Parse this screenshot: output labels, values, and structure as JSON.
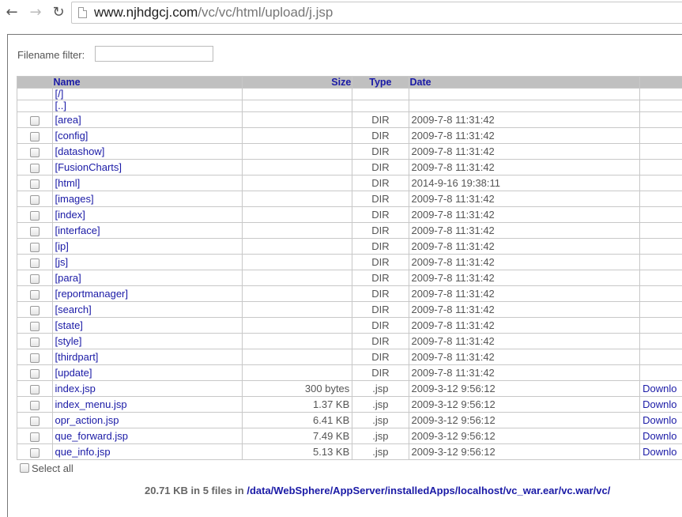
{
  "browser": {
    "back_icon": "arrow-left-icon",
    "forward_icon": "arrow-right-icon",
    "reload_icon": "reload-icon",
    "url_domain": "www.njhdgcj.com",
    "url_path": "/vc/vc/html/upload/j.jsp"
  },
  "filter": {
    "label": "Filename filter:",
    "value": ""
  },
  "table": {
    "headers": {
      "name": "Name",
      "size": "Size",
      "type": "Type",
      "date": "Date"
    },
    "parents": [
      "[/]",
      "[..]"
    ],
    "rows": [
      {
        "name": "[area]",
        "size": "",
        "type": "DIR",
        "date": "2009-7-8 11:31:42",
        "link": ""
      },
      {
        "name": "[config]",
        "size": "",
        "type": "DIR",
        "date": "2009-7-8 11:31:42",
        "link": ""
      },
      {
        "name": "[datashow]",
        "size": "",
        "type": "DIR",
        "date": "2009-7-8 11:31:42",
        "link": ""
      },
      {
        "name": "[FusionCharts]",
        "size": "",
        "type": "DIR",
        "date": "2009-7-8 11:31:42",
        "link": ""
      },
      {
        "name": "[html]",
        "size": "",
        "type": "DIR",
        "date": "2014-9-16 19:38:11",
        "link": ""
      },
      {
        "name": "[images]",
        "size": "",
        "type": "DIR",
        "date": "2009-7-8 11:31:42",
        "link": ""
      },
      {
        "name": "[index]",
        "size": "",
        "type": "DIR",
        "date": "2009-7-8 11:31:42",
        "link": ""
      },
      {
        "name": "[interface]",
        "size": "",
        "type": "DIR",
        "date": "2009-7-8 11:31:42",
        "link": ""
      },
      {
        "name": "[ip]",
        "size": "",
        "type": "DIR",
        "date": "2009-7-8 11:31:42",
        "link": ""
      },
      {
        "name": "[js]",
        "size": "",
        "type": "DIR",
        "date": "2009-7-8 11:31:42",
        "link": ""
      },
      {
        "name": "[para]",
        "size": "",
        "type": "DIR",
        "date": "2009-7-8 11:31:42",
        "link": ""
      },
      {
        "name": "[reportmanager]",
        "size": "",
        "type": "DIR",
        "date": "2009-7-8 11:31:42",
        "link": ""
      },
      {
        "name": "[search]",
        "size": "",
        "type": "DIR",
        "date": "2009-7-8 11:31:42",
        "link": ""
      },
      {
        "name": "[state]",
        "size": "",
        "type": "DIR",
        "date": "2009-7-8 11:31:42",
        "link": ""
      },
      {
        "name": "[style]",
        "size": "",
        "type": "DIR",
        "date": "2009-7-8 11:31:42",
        "link": ""
      },
      {
        "name": "[thirdpart]",
        "size": "",
        "type": "DIR",
        "date": "2009-7-8 11:31:42",
        "link": ""
      },
      {
        "name": "[update]",
        "size": "",
        "type": "DIR",
        "date": "2009-7-8 11:31:42",
        "link": ""
      },
      {
        "name": "index.jsp",
        "size": "300 bytes",
        "type": ".jsp",
        "date": "2009-3-12 9:56:12",
        "link": "Downlo"
      },
      {
        "name": "index_menu.jsp",
        "size": "1.37 KB",
        "type": ".jsp",
        "date": "2009-3-12 9:56:12",
        "link": "Downlo"
      },
      {
        "name": "opr_action.jsp",
        "size": "6.41 KB",
        "type": ".jsp",
        "date": "2009-3-12 9:56:12",
        "link": "Downlo"
      },
      {
        "name": "que_forward.jsp",
        "size": "7.49 KB",
        "type": ".jsp",
        "date": "2009-3-12 9:56:12",
        "link": "Downlo"
      },
      {
        "name": "que_info.jsp",
        "size": "5.13 KB",
        "type": ".jsp",
        "date": "2009-3-12 9:56:12",
        "link": "Downlo"
      }
    ]
  },
  "select_all_label": "Select all",
  "summary": {
    "text": "20.71 KB in 5 files in",
    "path": "/data/WebSphere/AppServer/installedApps/localhost/vc_war.ear/vc.war/vc/"
  }
}
